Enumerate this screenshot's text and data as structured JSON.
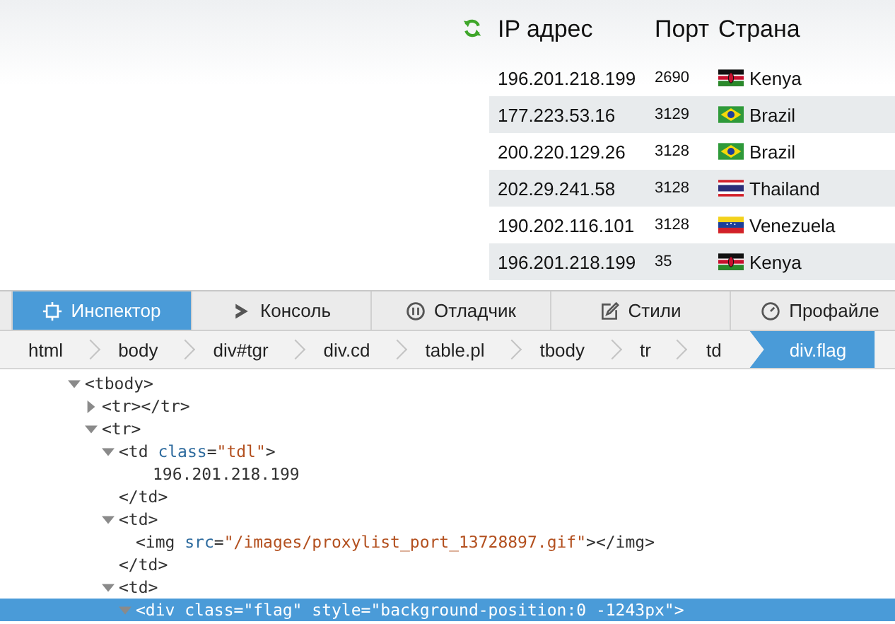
{
  "proxy_table": {
    "columns": [
      "IP адрес",
      "Порт",
      "Страна"
    ],
    "rows": [
      {
        "ip": "196.201.218.199",
        "port": "2690",
        "country": "Kenya",
        "kind": "kenya"
      },
      {
        "ip": "177.223.53.16",
        "port": "3129",
        "country": "Brazil",
        "kind": "brazil"
      },
      {
        "ip": "200.220.129.26",
        "port": "3128",
        "country": "Brazil",
        "kind": "brazil"
      },
      {
        "ip": "202.29.241.58",
        "port": "3128",
        "country": "Thailand",
        "kind": "thailand"
      },
      {
        "ip": "190.202.116.101",
        "port": "3128",
        "country": "Venezuela",
        "kind": "venezuela"
      },
      {
        "ip": "196.201.218.199",
        "port": "35",
        "country": "Kenya",
        "kind": "kenya"
      }
    ]
  },
  "devtools": {
    "tabs": [
      {
        "label": "Инспектор",
        "kind": "inspector",
        "selected": true
      },
      {
        "label": "Консоль",
        "kind": "console",
        "selected": false
      },
      {
        "label": "Отладчик",
        "kind": "debugger",
        "selected": false
      },
      {
        "label": "Стили",
        "kind": "styles",
        "selected": false
      },
      {
        "label": "Профайле",
        "kind": "profiler",
        "selected": false
      }
    ],
    "breadcrumbs": [
      {
        "label": "html",
        "selected": false
      },
      {
        "label": "body",
        "selected": false
      },
      {
        "label": "div#tgr",
        "selected": false
      },
      {
        "label": "div.cd",
        "selected": false
      },
      {
        "label": "table.pl",
        "selected": false
      },
      {
        "label": "tbody",
        "selected": false
      },
      {
        "label": "tr",
        "selected": false
      },
      {
        "label": "td",
        "selected": false
      },
      {
        "label": "div.flag",
        "selected": true
      }
    ],
    "tree": [
      {
        "kind": "element",
        "expanded": true,
        "selected": false,
        "open": [
          {
            "kind": "tag",
            "text": "<tbody>"
          }
        ],
        "children": [
          {
            "kind": "element",
            "expanded": false,
            "selected": false,
            "open": [
              {
                "kind": "tag",
                "text": "<tr></tr>"
              }
            ]
          },
          {
            "kind": "element",
            "expanded": true,
            "selected": false,
            "open": [
              {
                "kind": "tag",
                "text": "<tr>"
              }
            ],
            "children": [
              {
                "kind": "element",
                "expanded": true,
                "selected": false,
                "open": [
                  {
                    "kind": "tag",
                    "text": "<td"
                  },
                  {
                    "kind": "attr",
                    "text": "class"
                  },
                  {
                    "kind": "tag",
                    "text": "="
                  },
                  {
                    "kind": "value",
                    "text": "\"tdl\""
                  },
                  {
                    "kind": "tag",
                    "text": ">"
                  }
                ],
                "close": "</td>",
                "children": [
                  {
                    "kind": "text",
                    "text": "196.201.218.199"
                  }
                ]
              },
              {
                "kind": "element",
                "expanded": true,
                "selected": false,
                "open": [
                  {
                    "kind": "tag",
                    "text": "<td>"
                  }
                ],
                "close": "</td>",
                "children": [
                  {
                    "kind": "leaf",
                    "selected": false,
                    "open": [
                      {
                        "kind": "tag",
                        "text": "<img"
                      },
                      {
                        "kind": "attr",
                        "text": "src"
                      },
                      {
                        "kind": "tag",
                        "text": "="
                      },
                      {
                        "kind": "value",
                        "text": "\"/images/proxylist_port_13728897.gif\""
                      },
                      {
                        "kind": "tag",
                        "text": "></img>"
                      }
                    ]
                  }
                ]
              },
              {
                "kind": "element",
                "expanded": true,
                "selected": false,
                "open": [
                  {
                    "kind": "tag",
                    "text": "<td>"
                  }
                ],
                "children": [
                  {
                    "kind": "element",
                    "expanded": true,
                    "selected": true,
                    "open": [
                      {
                        "kind": "tag",
                        "text": "<div"
                      },
                      {
                        "kind": "attr",
                        "text": "class"
                      },
                      {
                        "kind": "tag",
                        "text": "="
                      },
                      {
                        "kind": "value",
                        "text": "\"flag\""
                      },
                      {
                        "kind": "attr",
                        "text": "style"
                      },
                      {
                        "kind": "tag",
                        "text": "="
                      },
                      {
                        "kind": "value",
                        "text": "\"background-position:0 -1243px\""
                      },
                      {
                        "kind": "tag",
                        "text": ">"
                      }
                    ]
                  }
                ]
              }
            ]
          }
        ]
      }
    ]
  }
}
